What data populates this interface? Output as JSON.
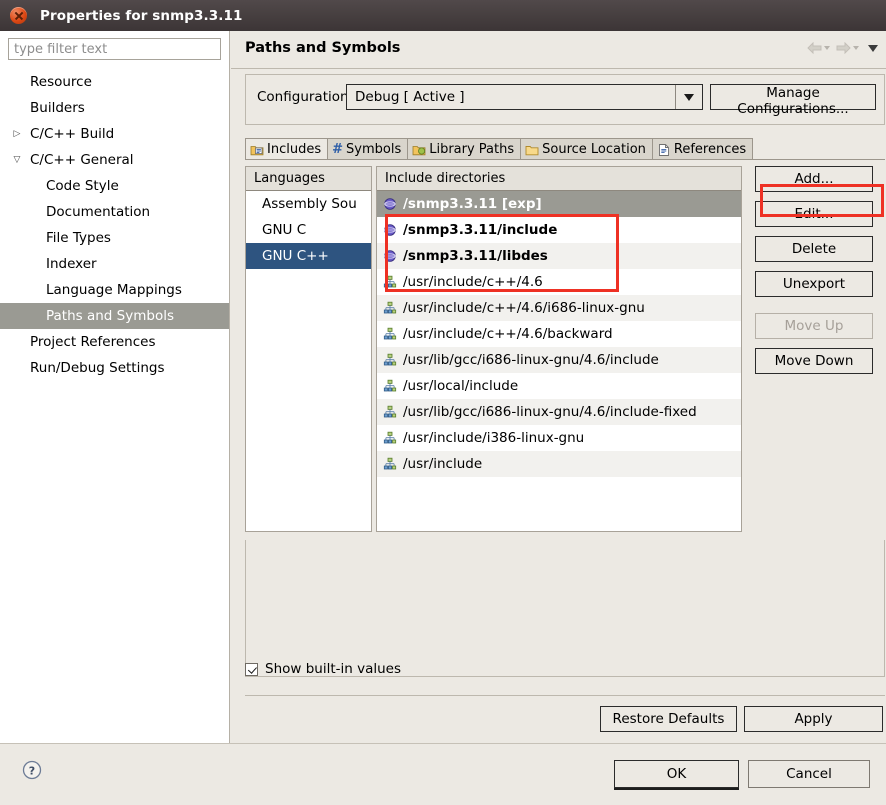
{
  "window": {
    "title": "Properties for snmp3.3.11",
    "close_icon": "close-icon"
  },
  "filter": {
    "placeholder": "type filter text",
    "value": ""
  },
  "tree": [
    {
      "label": "Resource",
      "depth": 0,
      "twisty": "",
      "selected": false
    },
    {
      "label": "Builders",
      "depth": 0,
      "twisty": "",
      "selected": false
    },
    {
      "label": "C/C++ Build",
      "depth": 0,
      "twisty": "▷",
      "selected": false
    },
    {
      "label": "C/C++ General",
      "depth": 0,
      "twisty": "▽",
      "selected": false
    },
    {
      "label": "Code Style",
      "depth": 1,
      "twisty": "",
      "selected": false
    },
    {
      "label": "Documentation",
      "depth": 1,
      "twisty": "",
      "selected": false
    },
    {
      "label": "File Types",
      "depth": 1,
      "twisty": "",
      "selected": false
    },
    {
      "label": "Indexer",
      "depth": 1,
      "twisty": "",
      "selected": false
    },
    {
      "label": "Language Mappings",
      "depth": 1,
      "twisty": "",
      "selected": false
    },
    {
      "label": "Paths and Symbols",
      "depth": 1,
      "twisty": "",
      "selected": true
    },
    {
      "label": "Project References",
      "depth": 0,
      "twisty": "",
      "selected": false
    },
    {
      "label": "Run/Debug Settings",
      "depth": 0,
      "twisty": "",
      "selected": false
    }
  ],
  "page": {
    "title": "Paths and Symbols",
    "nav": {
      "back_icon": "back-arrow-icon",
      "forward_icon": "forward-arrow-icon",
      "menu_icon": "chevron-down-icon"
    }
  },
  "configuration": {
    "label": "Configuration:",
    "selected": "Debug  [ Active ]",
    "options": [
      "Debug  [ Active ]"
    ],
    "manage_button": "Manage Configurations...",
    "dropdown_icon": "chevron-down-icon"
  },
  "tabs": [
    {
      "label": "Includes",
      "icon": "include-folder-icon",
      "active": true
    },
    {
      "label": "Symbols",
      "icon": "hash-icon",
      "active": false
    },
    {
      "label": "Library Paths",
      "icon": "library-folder-icon",
      "active": false
    },
    {
      "label": "Source Location",
      "icon": "folder-icon",
      "active": false
    },
    {
      "label": "References",
      "icon": "document-icon",
      "active": false
    }
  ],
  "languages": {
    "header": "Languages",
    "rows": [
      {
        "label": "Assembly Sou",
        "selected": false
      },
      {
        "label": "GNU C",
        "selected": false
      },
      {
        "label": "GNU C++",
        "selected": true
      }
    ]
  },
  "include_directories": {
    "header": "Include directories",
    "rows": [
      {
        "label": "/snmp3.3.11 [exp]",
        "icon": "export-sphere-icon",
        "exported": true,
        "selected": true
      },
      {
        "label": "/snmp3.3.11/include",
        "icon": "export-sphere-icon",
        "exported": true,
        "selected": false
      },
      {
        "label": "/snmp3.3.11/libdes",
        "icon": "export-sphere-icon",
        "exported": true,
        "selected": false
      },
      {
        "label": "/usr/include/c++/4.6",
        "icon": "builtin-tree-icon",
        "exported": false,
        "selected": false
      },
      {
        "label": "/usr/include/c++/4.6/i686-linux-gnu",
        "icon": "builtin-tree-icon",
        "exported": false,
        "selected": false
      },
      {
        "label": "/usr/include/c++/4.6/backward",
        "icon": "builtin-tree-icon",
        "exported": false,
        "selected": false
      },
      {
        "label": "/usr/lib/gcc/i686-linux-gnu/4.6/include",
        "icon": "builtin-tree-icon",
        "exported": false,
        "selected": false
      },
      {
        "label": "/usr/local/include",
        "icon": "builtin-tree-icon",
        "exported": false,
        "selected": false
      },
      {
        "label": "/usr/lib/gcc/i686-linux-gnu/4.6/include-fixed",
        "icon": "builtin-tree-icon",
        "exported": false,
        "selected": false
      },
      {
        "label": "/usr/include/i386-linux-gnu",
        "icon": "builtin-tree-icon",
        "exported": false,
        "selected": false
      },
      {
        "label": "/usr/include",
        "icon": "builtin-tree-icon",
        "exported": false,
        "selected": false
      }
    ]
  },
  "side_buttons": [
    {
      "label": "Add...",
      "enabled": true,
      "highlighted": true
    },
    {
      "label": "Edit...",
      "enabled": true,
      "highlighted": false
    },
    {
      "label": "Delete",
      "enabled": true,
      "highlighted": false
    },
    {
      "label": "Unexport",
      "enabled": true,
      "highlighted": false
    },
    {
      "label": "Move Up",
      "enabled": false,
      "highlighted": false
    },
    {
      "label": "Move Down",
      "enabled": true,
      "highlighted": false
    }
  ],
  "builtin": {
    "label": "Show built-in values",
    "checked": true
  },
  "page_buttons": {
    "restore_defaults": "Restore Defaults",
    "apply": "Apply"
  },
  "footer": {
    "help_icon": "help-question-icon",
    "ok": "OK",
    "cancel": "Cancel"
  },
  "annotations": {
    "accent_color": "#ee3124",
    "highlight_paths": "red-box-around-project-include-paths",
    "highlight_add": "red-box-around-add-button"
  }
}
